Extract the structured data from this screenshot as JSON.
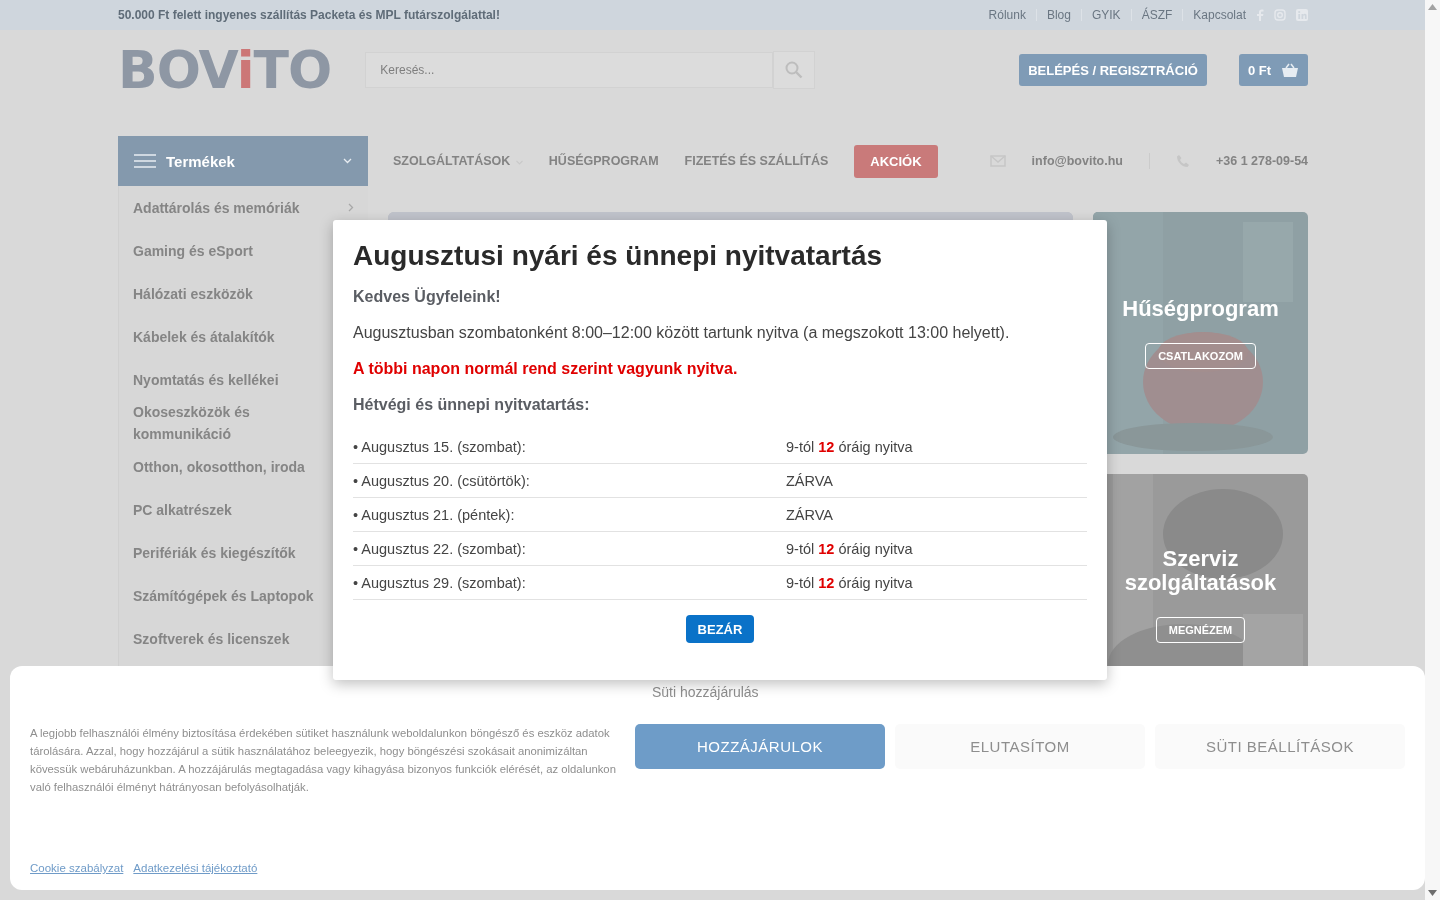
{
  "top_bar": {
    "promo": "50.000 Ft felett ingyenes szállítás Packeta és MPL futárszolgálattal!",
    "links": [
      "Rólunk",
      "Blog",
      "GYIK",
      "ÁSZF",
      "Kapcsolat"
    ]
  },
  "header": {
    "logo": [
      {
        "text": "BOV",
        "color": "#8e97a4"
      },
      {
        "text": "i",
        "color": "#cc7777"
      },
      {
        "text": "TO",
        "color": "#8e97a4"
      }
    ],
    "search": {
      "placeholder": "Keresés..."
    },
    "login": "BELÉPÉS / REGISZTRÁCIÓ",
    "cart": "0 Ft"
  },
  "categories": {
    "title": "Termékek",
    "items": [
      {
        "label": "Adattárolás és memóriák"
      },
      {
        "label": "Gaming és eSport"
      },
      {
        "label": "Hálózati eszközök"
      },
      {
        "label": "Kábelek és átalakítók"
      },
      {
        "label": "Nyomtatás és kellékei"
      },
      {
        "label": "Okoseszközök és kommunikáció"
      },
      {
        "label": "Otthon, okosotthon, iroda"
      },
      {
        "label": "PC alkatrészek"
      },
      {
        "label": "Perifériák és kiegészítők"
      },
      {
        "label": "Számítógépek és Laptopok"
      },
      {
        "label": "Szoftverek és licenszek"
      }
    ]
  },
  "nav": [
    {
      "label": "SZOLGÁLTATÁSOK",
      "kind": "dropdown"
    },
    {
      "label": "HŰSÉGPROGRAM",
      "kind": "link"
    },
    {
      "label": "FIZETÉS ÉS SZÁLLÍTÁS",
      "kind": "link"
    },
    {
      "label": "AKCIÓK",
      "kind": "highlight"
    }
  ],
  "contact": {
    "email": "info@bovito.hu",
    "phone": "+36 1 278-09-54"
  },
  "promo_cards": [
    {
      "kind": "picture",
      "title": "Hűségprogram",
      "button": "CSATLAKOZOM"
    },
    {
      "kind": "picture",
      "title": "Szerviz szolgáltatások",
      "button": "MEGNÉZEM"
    }
  ],
  "modal": {
    "title": "Augusztusi nyári és ünnepi nyitvatartás",
    "greeting": "Kedves Ügyfeleink!",
    "notice": "Augusztusban szombatonként 8:00–12:00 között tartunk nyitva (a megszokott 13:00 helyett).",
    "highlight": "A többi napon normál rend szerint vagyunk nyitva.",
    "subtitle": "Hétvégi és ünnepi nyitvatartás:",
    "rows": [
      {
        "day": "• Augusztus 15. (szombat):",
        "hours": "9-tól **12** óráig nyitva"
      },
      {
        "day": "• Augusztus 20. (csütörtök):",
        "hours": "ZÁRVA"
      },
      {
        "day": "• Augusztus 21. (péntek):",
        "hours": "ZÁRVA"
      },
      {
        "day": "• Augusztus 22. (szombat):",
        "hours": "9-tól **12** óráig nyitva"
      },
      {
        "day": "• Augusztus 29. (szombat):",
        "hours": "9-tól **12** óráig nyitva"
      }
    ],
    "close": "BEZÁR"
  },
  "cookie_banner": {
    "title": "Süti hozzájárulás",
    "text": "A legjobb felhasználói élmény biztosítása érdekében sütiket használunk weboldalunkon böngésző és eszköz adatok tárolására. Azzal, hogy hozzájárul a sütik használatához beleegyezik, hogy böngészési szokásait anonimizáltan kövessük webáruházunkban. A hozzájárulás megtagadása vagy kihagyása bizonyos funkciók elérését, az oldalunkon való felhasználói élményt hátrányosan befolyásolhatják.",
    "buttons": [
      {
        "label": "HOZZÁJÁRULOK",
        "kind": "primary"
      },
      {
        "label": "ELUTASÍTOM",
        "kind": "secondary"
      },
      {
        "label": "SÜTI BEÁLLÍTÁSOK",
        "kind": "secondary"
      }
    ],
    "links": [
      "Cookie szabályzat",
      "Adatkezelési tájékoztató"
    ]
  }
}
